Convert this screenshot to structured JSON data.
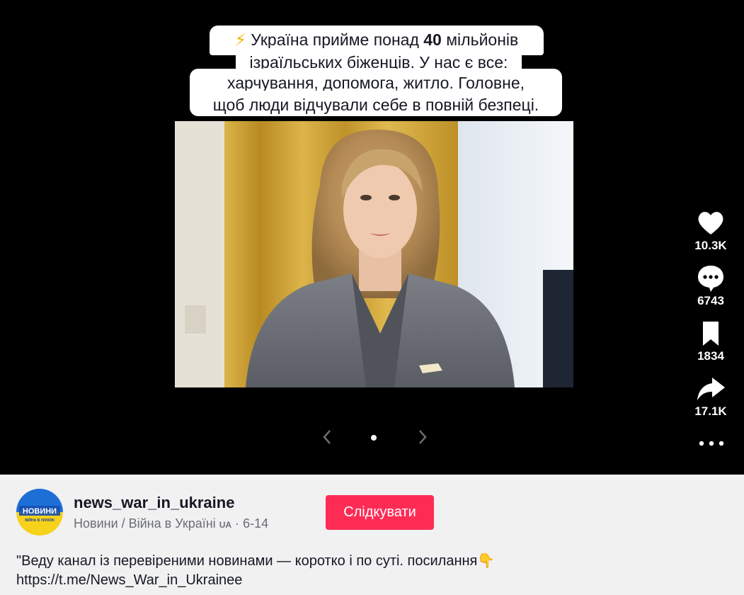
{
  "caption": {
    "line1_prefix": "⚡",
    "line1_text_a": " Україна прийме понад ",
    "line1_bold": "40",
    "line1_text_b": " мільйонів",
    "line2": "ізраїльських біженців. У нас є все:",
    "line3": "харчування, допомога, житло. Головне,",
    "line4": "щоб люди відчували себе в повній безпеці."
  },
  "actions": {
    "likes": "10.3K",
    "comments": "6743",
    "saves": "1834",
    "shares": "17.1K"
  },
  "icons": {
    "like": "heart-icon",
    "comment": "comment-icon",
    "save": "bookmark-icon",
    "share": "share-arrow-icon",
    "more": "more-dots-icon",
    "prev": "chevron-left-icon",
    "next": "chevron-right-icon"
  },
  "author": {
    "username": "news_war_in_ukraine",
    "nickname": "Новини / Війна в Україні",
    "flag": "UA",
    "date_separator": "·",
    "date": "6-14",
    "avatar_text": "НОВИНИ",
    "avatar_subtext": "ВІЙНА В УКРАЇНІ"
  },
  "follow_label": "Слідкувати",
  "description": {
    "line1": "\"Веду канал із перевіреними новинами — коротко і по суті. посилання",
    "emoji": "👇",
    "line2": "https://t.me/News_War_in_Ukrainee"
  },
  "colors": {
    "accent": "#fe2c55",
    "video_bg": "#000000",
    "panel_bg": "#f1f1f2"
  }
}
